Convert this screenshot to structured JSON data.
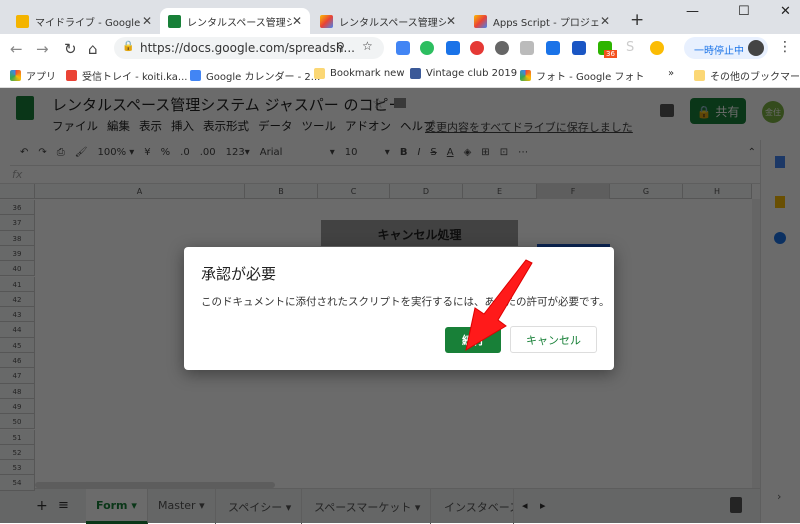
{
  "browser": {
    "tabs": [
      {
        "label": "マイドライブ - Google ドライブ",
        "icon": "google-drive-icon",
        "color": "#f4b400"
      },
      {
        "label": "レンタルスペース管理システム",
        "icon": "google-sheets-icon",
        "color": "#188038",
        "active": true
      },
      {
        "label": "レンタルスペース管理システム",
        "icon": "apps-script-icon",
        "color": "#4285f4"
      },
      {
        "label": "Apps Script - プロジェクト",
        "icon": "apps-script-icon",
        "color": "#4285f4"
      }
    ],
    "url": "https://docs.google.com/spreadsh...",
    "pause_label": "一時停止中",
    "extension_badge": "36",
    "bookmarks": [
      "アプリ",
      "受信トレイ - koiti.ka...",
      "Google カレンダー - 2...",
      "Bookmark new",
      "Vintage club 2019",
      "フォト - Google フォト"
    ],
    "more": "»",
    "other_bookmarks": "その他のブックマーク"
  },
  "sheets": {
    "title": "レンタルスペース管理システム ジャスパー のコピー",
    "menu": [
      "ファイル",
      "編集",
      "表示",
      "挿入",
      "表示形式",
      "データ",
      "ツール",
      "アドオン",
      "ヘルプ"
    ],
    "saved_status": "変更内容をすべてドライブに保存しました",
    "share_label": "共有",
    "avatar": "金住",
    "toolbar": {
      "zoom": "100%",
      "currency": "¥",
      "percent": "%",
      "dec_less": ".0",
      "dec_more": ".00",
      "format": "123",
      "font": "Arial",
      "size": "10",
      "bold": "B",
      "italic": "I",
      "strike": "S",
      "textcolor": "A",
      "more": "⋯"
    },
    "fx": "fx",
    "columns": [
      "A",
      "B",
      "C",
      "D",
      "E",
      "F",
      "G",
      "H"
    ],
    "rows": [
      "36",
      "37",
      "38",
      "39",
      "40",
      "41",
      "42",
      "43",
      "44",
      "45",
      "46",
      "47",
      "48",
      "49",
      "50",
      "51",
      "52",
      "53",
      "54"
    ],
    "cell_button": "キャンセル処理",
    "sheet_tabs": [
      "Form",
      "Master",
      "スペイシー",
      "スペースマーケット",
      "インスタベース"
    ]
  },
  "dialog": {
    "title": "承認が必要",
    "message": "このドキュメントに添付されたスクリプトを実行するには、あなたの許可が必要です。",
    "continue_label": "続行",
    "cancel_label": "キャンセル"
  },
  "colors": {
    "accent": "#188038",
    "annotation_arrow": "#ff0000"
  }
}
